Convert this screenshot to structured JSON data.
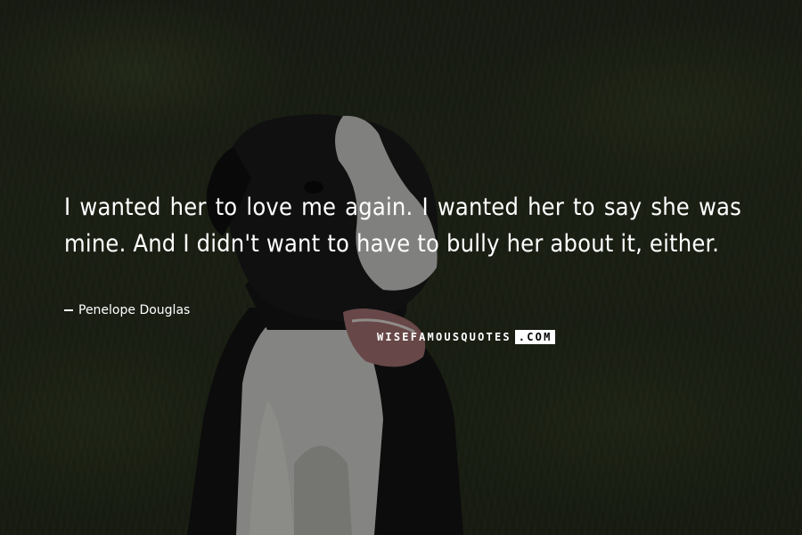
{
  "quote": {
    "text": "I wanted her to love me again. I wanted her to say she was mine. And I didn't want to have to bully her about it, either.",
    "author": "Penelope Douglas"
  },
  "watermark": {
    "left": "WISEFAMOUSQUOTES",
    "right": ".COM"
  }
}
